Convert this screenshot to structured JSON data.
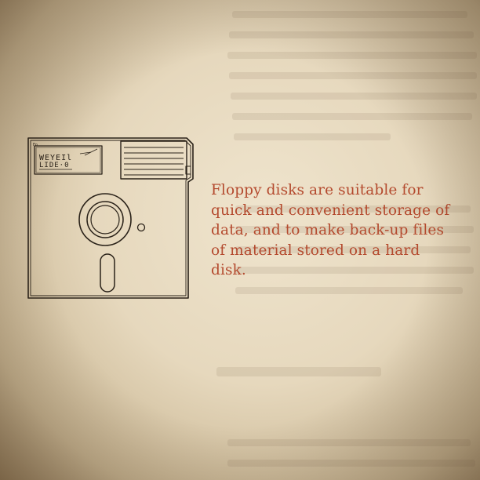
{
  "caption": {
    "lines": [
      "Floppy disks are suitable for",
      "quick and convenient storage of",
      "data, and to make back-up files",
      "of material stored on a hard",
      "disk."
    ]
  },
  "disk_label": {
    "handwritten_line1": "WEYEIl",
    "handwritten_line2": "LIDE·0"
  },
  "colors": {
    "caption_text": "#b44a2e",
    "illustration_ink": "#2a2219",
    "paper": "#e3d6be"
  }
}
